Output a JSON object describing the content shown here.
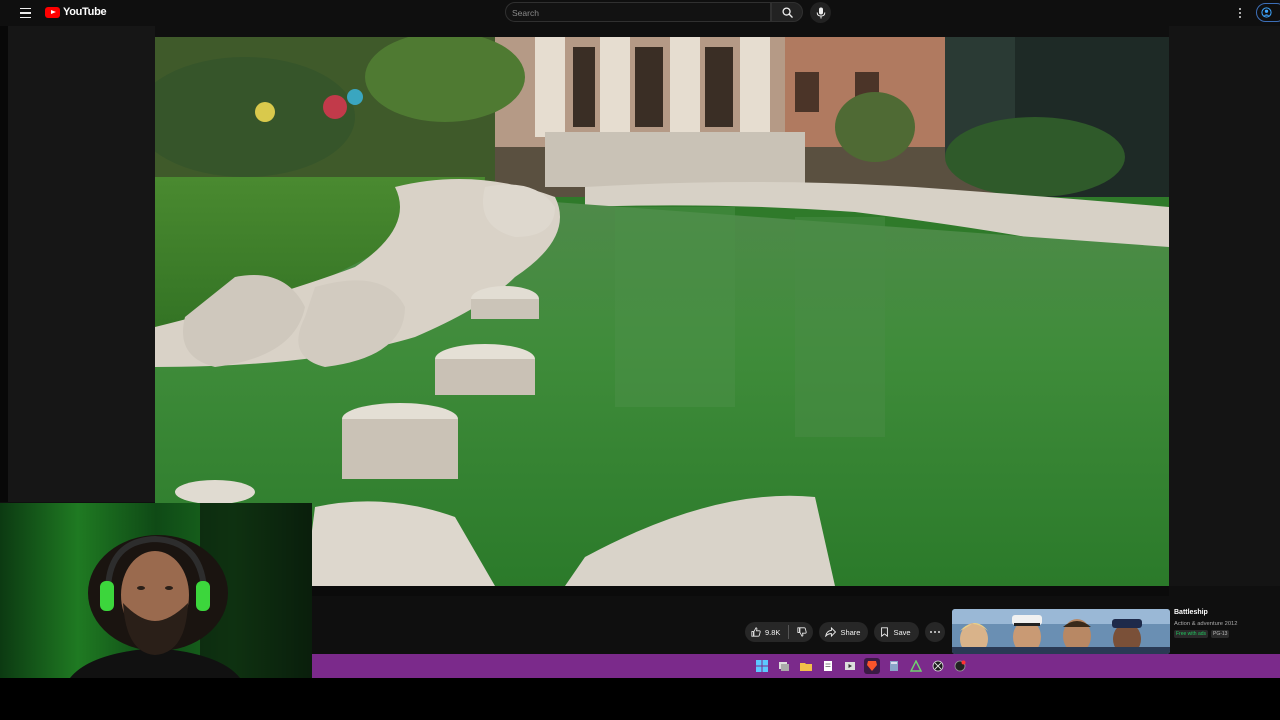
{
  "app": {
    "logo_text": "YouTube"
  },
  "search": {
    "placeholder": "Search"
  },
  "actions": {
    "like_count": "9.8K",
    "share_label": "Share",
    "save_label": "Save"
  },
  "ad": {
    "title": "Battleship",
    "subtitle": "Action & adventure 2012",
    "badge_free": "Free with ads",
    "badge_rating": "PG-13"
  },
  "icons": {
    "menu": "hamburger-icon",
    "search": "search-icon",
    "mic": "microphone-icon",
    "more": "kebab-icon",
    "account": "account-circle-icon",
    "like": "thumbs-up-icon",
    "dislike": "thumbs-down-icon",
    "share": "share-arrow-icon",
    "save": "bookmark-icon",
    "taskbar": [
      "windows-start-icon",
      "task-view-icon",
      "file-explorer-icon",
      "notepad-icon",
      "media-player-icon",
      "brave-browser-icon",
      "calculator-icon",
      "app-triangle-icon",
      "xbox-icon",
      "record-icon"
    ]
  },
  "colors": {
    "brand_red": "#ff0000",
    "taskbar_purple": "#7b2a8b",
    "page_bg": "#0f0f0f",
    "free_badge_green": "#22c55e"
  }
}
